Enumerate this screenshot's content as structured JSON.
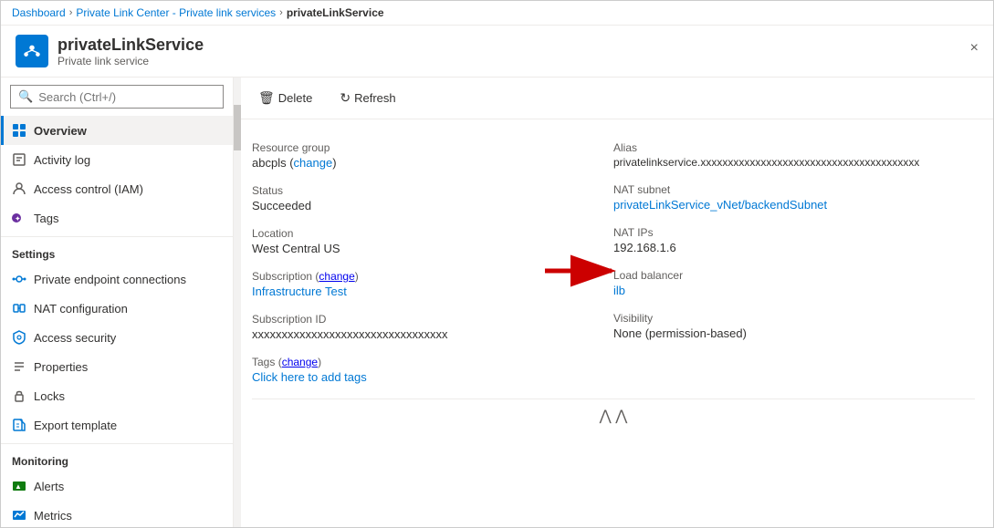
{
  "breadcrumb": {
    "items": [
      {
        "label": "Dashboard",
        "link": true
      },
      {
        "label": "Private Link Center - Private link services",
        "link": true
      },
      {
        "label": "privateLinkService",
        "link": false
      }
    ]
  },
  "header": {
    "title": "privateLinkService",
    "subtitle": "Private link service",
    "close_label": "×"
  },
  "toolbar": {
    "delete_label": "Delete",
    "refresh_label": "Refresh"
  },
  "search": {
    "placeholder": "Search (Ctrl+/)"
  },
  "sidebar": {
    "nav_items": [
      {
        "id": "overview",
        "label": "Overview",
        "active": true,
        "icon": "overview"
      },
      {
        "id": "activity-log",
        "label": "Activity log",
        "active": false,
        "icon": "activity"
      },
      {
        "id": "access-control",
        "label": "Access control (IAM)",
        "active": false,
        "icon": "iam"
      },
      {
        "id": "tags",
        "label": "Tags",
        "active": false,
        "icon": "tags"
      }
    ],
    "sections": [
      {
        "title": "Settings",
        "items": [
          {
            "id": "private-endpoint",
            "label": "Private endpoint connections",
            "icon": "endpoint"
          },
          {
            "id": "nat-config",
            "label": "NAT configuration",
            "icon": "nat"
          },
          {
            "id": "access-security",
            "label": "Access security",
            "icon": "security"
          },
          {
            "id": "properties",
            "label": "Properties",
            "icon": "properties"
          },
          {
            "id": "locks",
            "label": "Locks",
            "icon": "locks"
          },
          {
            "id": "export-template",
            "label": "Export template",
            "icon": "template"
          }
        ]
      },
      {
        "title": "Monitoring",
        "items": [
          {
            "id": "alerts",
            "label": "Alerts",
            "icon": "alerts"
          },
          {
            "id": "metrics",
            "label": "Metrics",
            "icon": "metrics"
          }
        ]
      }
    ]
  },
  "details": {
    "resource_group_label": "Resource group",
    "resource_group_value": "abcpls",
    "resource_group_change": "change",
    "alias_label": "Alias",
    "alias_value": "privatelinkservice.xxxxxxxxxxxxxxxxxxxxxxxxxxxxxxxxxxxxxxxx",
    "status_label": "Status",
    "status_value": "Succeeded",
    "nat_subnet_label": "NAT subnet",
    "nat_subnet_value": "privateLinkService_vNet/backendSubnet",
    "location_label": "Location",
    "location_value": "West Central US",
    "nat_ips_label": "NAT IPs",
    "nat_ips_value": "192.168.1.6",
    "subscription_label": "Subscription",
    "subscription_change": "change",
    "subscription_value": "Infrastructure Test",
    "load_balancer_label": "Load balancer",
    "load_balancer_value": "ilb",
    "subscription_id_label": "Subscription ID",
    "subscription_id_value": "xxxxxxxxxxxxxxxxxxxxxxxxxxxxxxxxx",
    "visibility_label": "Visibility",
    "visibility_value": "None (permission-based)",
    "tags_label": "Tags",
    "tags_change": "change",
    "tags_add": "Click here to add tags"
  }
}
